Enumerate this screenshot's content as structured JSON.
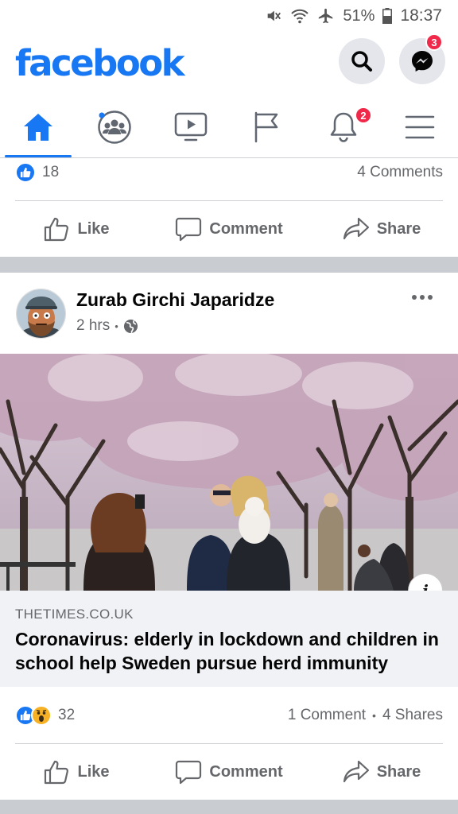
{
  "status_bar": {
    "battery": "51%",
    "time": "18:37"
  },
  "header": {
    "logo": "facebook",
    "messenger_badge": "3"
  },
  "nav": {
    "notifications_badge": "2"
  },
  "previous_post": {
    "reaction_count": "18",
    "comments": "4 Comments",
    "actions": {
      "like": "Like",
      "comment": "Comment",
      "share": "Share"
    }
  },
  "post": {
    "author": "Zurab Girchi Japaridze",
    "time": "2 hrs",
    "separator": "•",
    "link": {
      "domain": "THETIMES.CO.UK",
      "title": "Coronavirus: elderly in lockdown and children in school help Sweden pursue herd immunity"
    },
    "reaction_count": "32",
    "comments": "1 Comment",
    "stats_separator": "•",
    "shares": "4 Shares",
    "actions": {
      "like": "Like",
      "comment": "Comment",
      "share": "Share"
    }
  },
  "colors": {
    "brand": "#1877f2",
    "badge": "#f02849",
    "muted": "#65676b",
    "wow": "#f7b125"
  },
  "icons": [
    "mute-icon",
    "wifi-icon",
    "airplane-icon",
    "battery-icon",
    "search-icon",
    "messenger-icon",
    "home-icon",
    "groups-icon",
    "watch-icon",
    "pages-flag-icon",
    "bell-icon",
    "menu-icon",
    "like-reaction-icon",
    "wow-reaction-icon",
    "globe-icon",
    "more-icon",
    "info-icon",
    "thumbs-up-icon",
    "comment-icon",
    "share-icon"
  ]
}
